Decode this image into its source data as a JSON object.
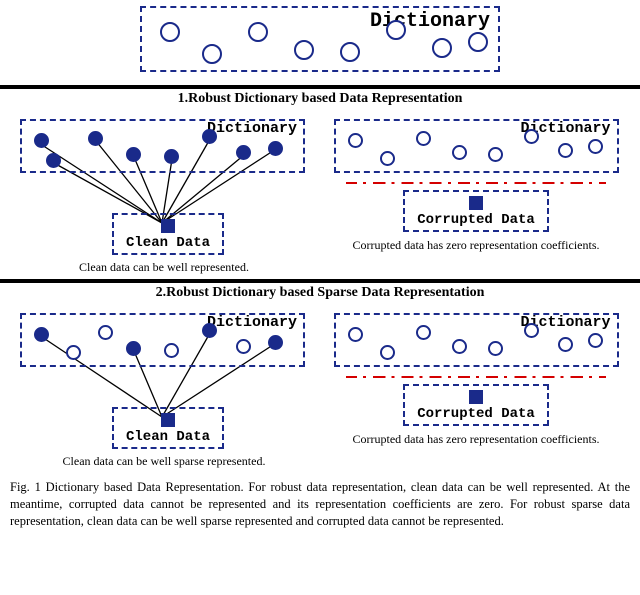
{
  "top": {
    "dict_label": "Dictionary"
  },
  "section1": {
    "title": "1.Robust Dictionary based Data Representation",
    "left": {
      "dict_label": "Dictionary",
      "data_label": "Clean Data",
      "caption": "Clean data can be well represented."
    },
    "right": {
      "dict_label": "Dictionary",
      "data_label": "Corrupted Data",
      "caption": "Corrupted data has zero representation coefficients."
    }
  },
  "section2": {
    "title": "2.Robust Dictionary based Sparse Data Representation",
    "left": {
      "dict_label": "Dictionary",
      "data_label": "Clean Data",
      "caption": "Clean data can be well sparse represented."
    },
    "right": {
      "dict_label": "Dictionary",
      "data_label": "Corrupted Data",
      "caption": "Corrupted data has zero representation coefficients."
    }
  },
  "figure_caption": "Fig. 1 Dictionary based Data Representation. For robust data representation, clean data can be well represented. At the meantime, corrupted data cannot be represented and its representation coefficients are zero. For robust sparse data representation, clean data can be well sparse represented and corrupted data cannot be represented."
}
